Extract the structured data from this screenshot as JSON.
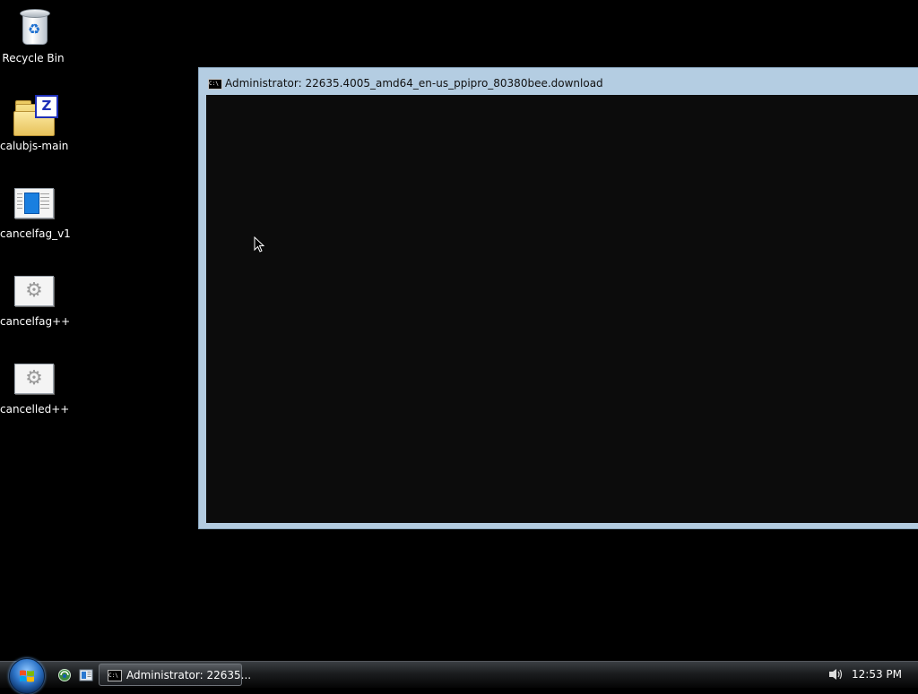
{
  "desktop": {
    "icons": [
      {
        "label": "Recycle Bin",
        "icon": "recycle-bin-icon"
      },
      {
        "label": "calubjs-main",
        "icon": "zip-folder-icon"
      },
      {
        "label": "cancelfag_v1",
        "icon": "application-window-icon"
      },
      {
        "label": "cancelfag++",
        "icon": "gears-application-icon"
      },
      {
        "label": "cancelled++",
        "icon": "gears-application-icon"
      }
    ]
  },
  "console_window": {
    "title": "Administrator:  22635.4005_amd64_en-us_ppipro_80380bee.download",
    "icon_text": "C:\\",
    "background": "#0c0c0c",
    "frame_color": "#b4cde2"
  },
  "taskbar": {
    "task_button_label": "Administrator:  22635...",
    "task_icon_text": "C:\\",
    "clock": "12:53 PM",
    "quick_launch": [
      "show-desktop-icon",
      "switch-windows-icon"
    ]
  },
  "colors": {
    "desktop_background": "#000000",
    "taskbar": "#1b1d1f",
    "start_orb": "#2d74c8"
  }
}
